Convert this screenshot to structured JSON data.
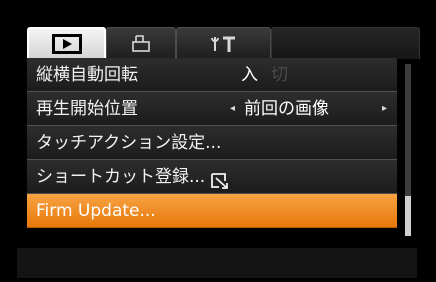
{
  "tabs": [
    {
      "icon": "play-icon",
      "active": true
    },
    {
      "icon": "print-icon",
      "active": false
    },
    {
      "icon": "tools-icon",
      "active": false
    }
  ],
  "menu": {
    "items": [
      {
        "label": "縦横自動回転",
        "value_on": "入",
        "value_off": "切"
      },
      {
        "label": "再生開始位置",
        "value": "前回の画像",
        "left_arrow": "◂",
        "right_arrow": "▸"
      },
      {
        "label": "タッチアクション設定..."
      },
      {
        "label": "ショートカット登録...",
        "icon": "shortcut-button-icon"
      },
      {
        "label": "Firm Update...",
        "selected": true
      }
    ]
  },
  "colors": {
    "selected_bg": "#f0901e",
    "row_bg": "#262626",
    "text": "#f2f2f2"
  },
  "scroll": {
    "position": "bottom"
  }
}
